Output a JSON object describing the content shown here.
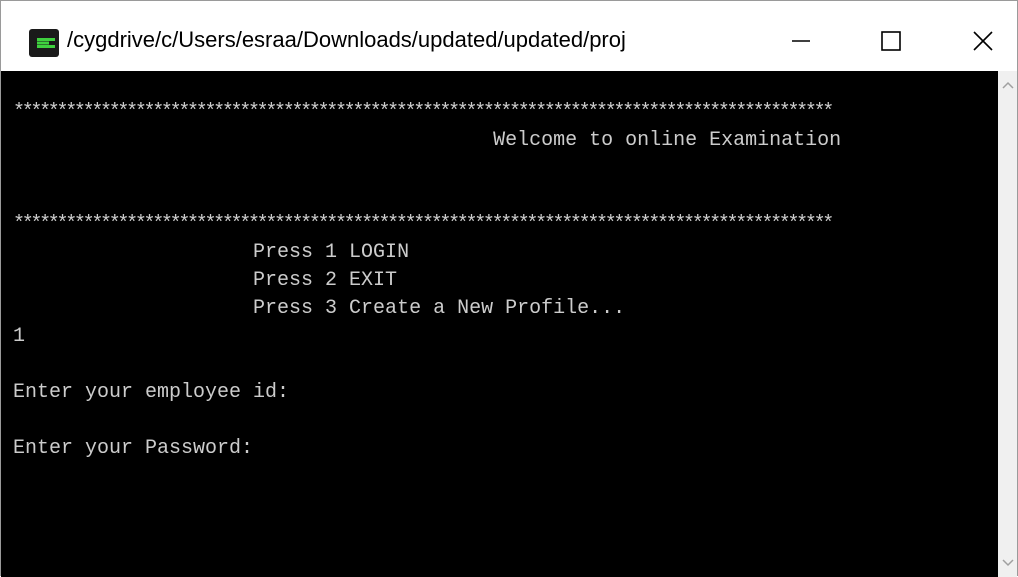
{
  "window": {
    "title": "/cygdrive/c/Users/esraa/Downloads/updated/updated/proj",
    "controls": {
      "minimize": "minimize-icon",
      "maximize": "maximize-icon",
      "close": "close-icon"
    },
    "icon": "cygwin-terminal-icon"
  },
  "colors": {
    "console_bg": "#000000",
    "console_text": "#cccccc",
    "titlebar_bg": "#ffffff",
    "icon_green": "#3fd13f"
  },
  "console": {
    "lines": [
      "**********************************************************************************************",
      "                                        Welcome to online Examination",
      "",
      "",
      "**********************************************************************************************",
      "                    Press 1 LOGIN",
      "                    Press 2 EXIT",
      "                    Press 3 Create a New Profile...",
      "1",
      "",
      "Enter your employee id:",
      "",
      "Enter your Password:",
      "",
      "",
      ""
    ]
  }
}
